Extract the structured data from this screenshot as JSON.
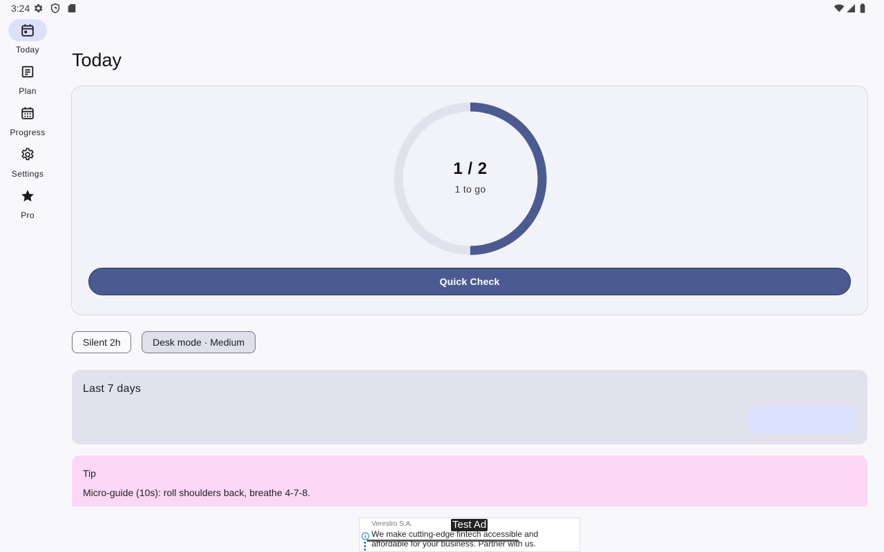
{
  "status_bar": {
    "time": "3:24",
    "left_icons": [
      "settings-icon",
      "shield-icon",
      "sd-card-icon"
    ],
    "right_icons": [
      "wifi-icon",
      "signal-icon",
      "battery-icon"
    ]
  },
  "nav_rail": {
    "items": [
      {
        "label": "Today",
        "icon": "calendar-today-icon",
        "active": true
      },
      {
        "label": "Plan",
        "icon": "plan-list-icon",
        "active": false
      },
      {
        "label": "Progress",
        "icon": "calendar-grid-icon",
        "active": false
      },
      {
        "label": "Settings",
        "icon": "gear-icon",
        "active": false
      },
      {
        "label": "Pro",
        "icon": "star-icon",
        "active": false
      }
    ]
  },
  "main": {
    "title": "Today",
    "progress": {
      "count_text": "1 / 2",
      "remaining_text": "1 to go",
      "completed": 1,
      "total": 2
    },
    "quick_check_label": "Quick Check",
    "chips": [
      {
        "label": "Silent 2h",
        "selected": false
      },
      {
        "label": "Desk mode · Medium",
        "selected": true
      }
    ],
    "week_card": {
      "title": "Last 7 days"
    },
    "tip": {
      "title": "Tip",
      "body": "Micro-guide (10s): roll shoulders back, breathe 4-7-8."
    }
  },
  "ad": {
    "label": "Test Ad",
    "advertiser": "Verestro S.A.",
    "copy": "We make cutting-edge fintech accessible and affordable for your business. Partner with us."
  },
  "colors": {
    "accent": "#4b5b92",
    "ring_track": "#e1e2ec",
    "nav_active": "#dce1fa",
    "week_card": "#e1e2ec",
    "tip_card": "#fcd7f6",
    "background": "#f8f8fc"
  }
}
